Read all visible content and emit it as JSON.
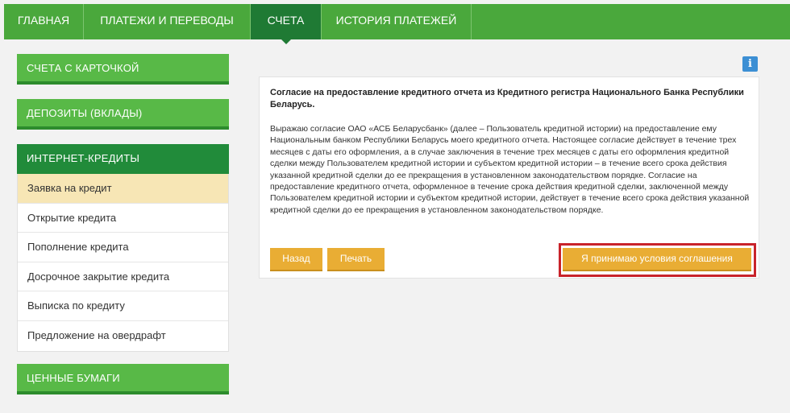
{
  "topnav": {
    "tabs": [
      {
        "label": "Главная"
      },
      {
        "label": "Платежи и переводы"
      },
      {
        "label": "Счета"
      },
      {
        "label": "История платежей"
      }
    ]
  },
  "sidebar": {
    "cards_accounts": "Счета с карточкой",
    "deposits": "Депозиты (вклады)",
    "internet_credits": "Интернет-кредиты",
    "credit_items": [
      {
        "label": "Заявка на кредит"
      },
      {
        "label": "Открытие кредита"
      },
      {
        "label": "Пополнение кредита"
      },
      {
        "label": "Досрочное закрытие кредита"
      },
      {
        "label": "Выписка по кредиту"
      },
      {
        "label": "Предложение на овердрафт"
      }
    ],
    "securities": "Ценные бумаги"
  },
  "info": {
    "glyph": "i"
  },
  "consent": {
    "title": "Согласие на предоставление кредитного отчета из Кредитного регистра Национального Банка Республики Беларусь.",
    "text": "Выражаю согласие ОАО «АСБ Беларусбанк» (далее – Пользователь кредитной истории) на предоставление ему Национальным банком Республики Беларусь моего кредитного отчета. Настоящее согласие действует в течение трех месяцев с даты его оформления, а в случае заключения в течение трех месяцев с даты его оформления кредитной сделки между Пользователем кредитной истории и субъектом кредитной истории – в течение всего срока действия указанной кредитной сделки до ее прекращения в установленном законодательством порядке. Согласие на предоставление кредитного отчета, оформленное в течение срока действия кредитной сделки, заключенной между Пользователем кредитной истории и субъектом кредитной истории, действует в течение всего срока действия указанной кредитной сделки до ее прекращения в установленном законодательством порядке.",
    "back_label": "Назад",
    "print_label": "Печать",
    "accept_label": "Я принимаю условия соглашения"
  },
  "colors": {
    "nav_green": "#4aa83c",
    "nav_active": "#1f7a34",
    "sidebar_green": "#58b947",
    "button_orange": "#e9ad34",
    "highlight_red": "#c8232a",
    "selected_item": "#f7e6b5"
  }
}
